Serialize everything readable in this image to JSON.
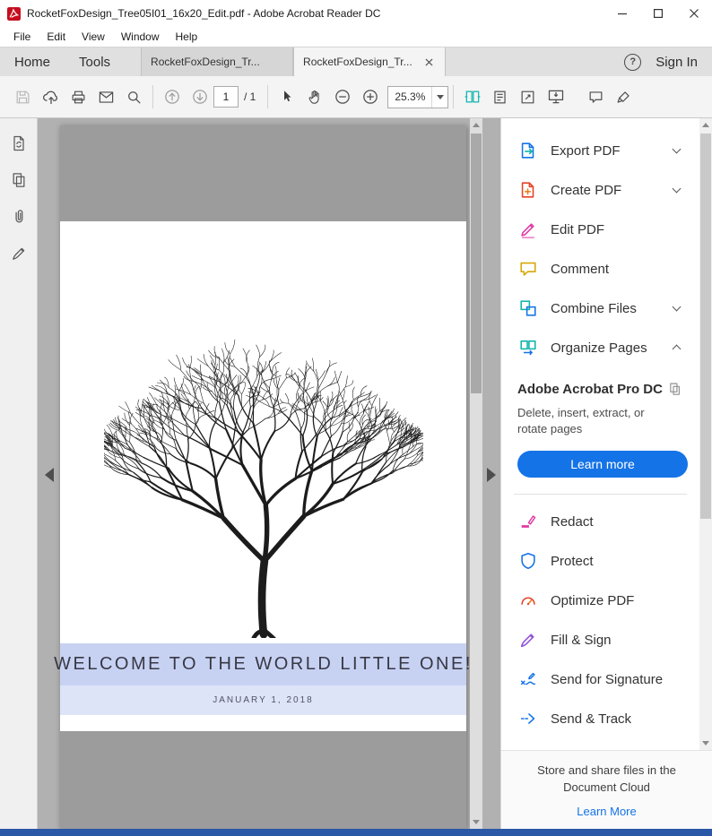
{
  "window": {
    "title": "RocketFoxDesign_Tree05I01_16x20_Edit.pdf - Adobe Acrobat Reader DC",
    "controls": [
      "minimize",
      "maximize",
      "close"
    ]
  },
  "menu": {
    "items": [
      "File",
      "Edit",
      "View",
      "Window",
      "Help"
    ]
  },
  "tab_bar": {
    "home": "Home",
    "tools": "Tools",
    "doc_tabs": [
      {
        "label": "RocketFoxDesign_Tr...",
        "active": false
      },
      {
        "label": "RocketFoxDesign_Tr...",
        "active": true
      }
    ],
    "help": "?",
    "sign_in": "Sign In"
  },
  "toolbar": {
    "page_current": "1",
    "page_total": "/ 1",
    "zoom": "25.3%",
    "icons": [
      "save",
      "cloud-upload",
      "print",
      "email",
      "search",
      "previous-page",
      "next-page",
      "select-tool",
      "hand-tool",
      "zoom-out",
      "zoom-in",
      "page-display",
      "fit-page",
      "zoom-level",
      "presentation-mode",
      "comment",
      "highlight"
    ]
  },
  "left_rail": {
    "icons": [
      "convert-pdf",
      "copy-pages",
      "attachments",
      "signature"
    ]
  },
  "pdf_page": {
    "banner_title": "WELCOME TO THE WORLD LITTLE ONE!",
    "banner_date": "JANUARY 1, 2018"
  },
  "right_panel": {
    "tools": [
      {
        "label": "Export PDF",
        "icon": "export-pdf-icon",
        "chevron": "down"
      },
      {
        "label": "Create PDF",
        "icon": "create-pdf-icon",
        "chevron": "down"
      },
      {
        "label": "Edit PDF",
        "icon": "edit-pdf-icon"
      },
      {
        "label": "Comment",
        "icon": "comment-icon"
      },
      {
        "label": "Combine Files",
        "icon": "combine-files-icon",
        "chevron": "down"
      },
      {
        "label": "Organize Pages",
        "icon": "organize-pages-icon",
        "chevron": "up"
      }
    ],
    "promo": {
      "title": "Adobe Acrobat Pro DC",
      "description": "Delete, insert, extract, or rotate pages",
      "button_label": "Learn more"
    },
    "more_tools": [
      {
        "label": "Redact",
        "icon": "redact-icon"
      },
      {
        "label": "Protect",
        "icon": "protect-icon"
      },
      {
        "label": "Optimize PDF",
        "icon": "optimize-pdf-icon"
      },
      {
        "label": "Fill & Sign",
        "icon": "fill-sign-icon"
      },
      {
        "label": "Send for Signature",
        "icon": "send-for-signature-icon"
      },
      {
        "label": "Send & Track",
        "icon": "send-track-icon"
      }
    ],
    "footer": {
      "text": "Store and share files in the Document Cloud",
      "link_label": "Learn More"
    }
  },
  "colors": {
    "accent_blue": "#1473e6",
    "banner_bg": "#c7d2f3",
    "date_band_bg": "#dde4f8",
    "page_band_gray": "#9c9c9c",
    "viewport_gray": "#b1b1b1",
    "taskbar_blue": "#2a57a6"
  }
}
